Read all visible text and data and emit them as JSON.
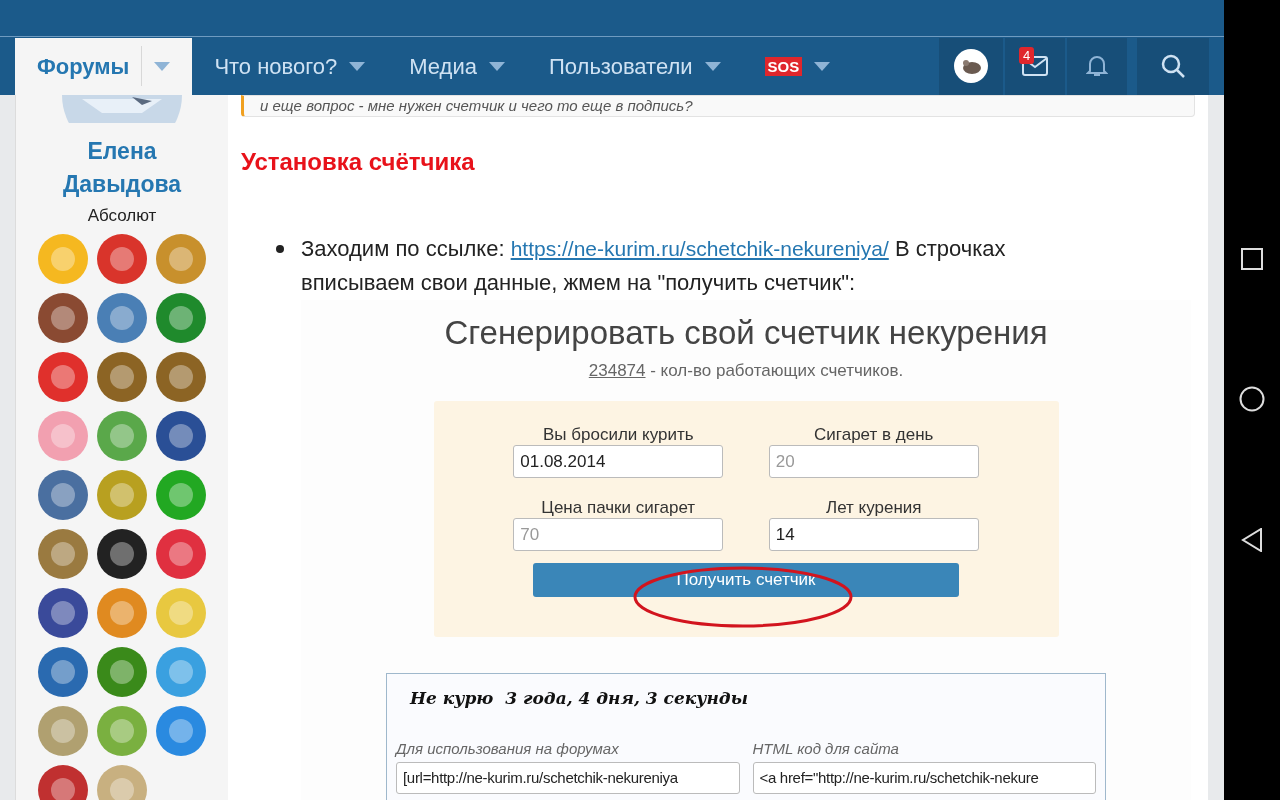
{
  "nav": {
    "items": [
      {
        "kind": "text",
        "label": "Форумы",
        "selected": true
      },
      {
        "kind": "text",
        "label": "Что нового?",
        "selected": false
      },
      {
        "kind": "text",
        "label": "Медиа",
        "selected": false
      },
      {
        "kind": "text",
        "label": "Пользователи",
        "selected": false
      },
      {
        "kind": "sos",
        "label": "SOS",
        "selected": false
      }
    ],
    "inbox_count": "4"
  },
  "sidebar": {
    "name": "Елена Давыдова",
    "title": "Абсолют",
    "badges": [
      {
        "color": "#f5b820"
      },
      {
        "color": "#d9342b"
      },
      {
        "color": "#c8902c"
      },
      {
        "color": "#8a4a32"
      },
      {
        "color": "#4a7fb5"
      },
      {
        "color": "#1f8a2c"
      },
      {
        "color": "#e0302c"
      },
      {
        "color": "#8c6424"
      },
      {
        "color": "#8c6424"
      },
      {
        "color": "#f2a0b0"
      },
      {
        "color": "#5aa84a"
      },
      {
        "color": "#2a4f96"
      },
      {
        "color": "#4a6fa0"
      },
      {
        "color": "#b8a020"
      },
      {
        "color": "#22a822"
      },
      {
        "color": "#9a7a40"
      },
      {
        "color": "#222222"
      },
      {
        "color": "#e03040"
      },
      {
        "color": "#3a4a9a"
      },
      {
        "color": "#e08a20"
      },
      {
        "color": "#e8c840"
      },
      {
        "color": "#2a6ab0"
      },
      {
        "color": "#3a8a1a"
      },
      {
        "color": "#3aa0e0"
      },
      {
        "color": "#b0a070"
      },
      {
        "color": "#7ab040"
      },
      {
        "color": "#2a8ae0"
      },
      {
        "color": "#c03030"
      },
      {
        "color": "#c8b080"
      }
    ]
  },
  "post": {
    "quote": "и еще вопрос - мне нужен счетчик и чего то еще в подпись?",
    "heading": "Установка счётчика",
    "bullet": {
      "before": "Заходим по ссылке: ",
      "link": "https://ne-kurim.ru/schetchik-nekureniya/",
      "after": " В строчках вписываем свои данные, жмем на \"получить счетчик\":"
    },
    "screenshot": {
      "title": "Сгенерировать свой счетчик некурения",
      "count": "234874",
      "count_text": " - кол-во работающих счетчиков.",
      "fields": [
        {
          "label": "Вы бросили курить",
          "value": "01.08.2014"
        },
        {
          "label": "Сигарет в день",
          "placeholder": "20"
        },
        {
          "label": "Цена пачки сигарет",
          "placeholder": "70"
        },
        {
          "label": "Лет курения",
          "value": "14"
        }
      ],
      "button": "Получить счетчик",
      "result": {
        "title": "Не курю  3 года, 4 дня, 3 секунды",
        "codes": [
          {
            "label": "Для использования на форумах",
            "value": "[url=http://ne-kurim.ru/schetchik-nekureniya"
          },
          {
            "label": "HTML код для сайта",
            "value": "<a href=\"http://ne-kurim.ru/schetchik-nekure"
          }
        ]
      }
    }
  }
}
